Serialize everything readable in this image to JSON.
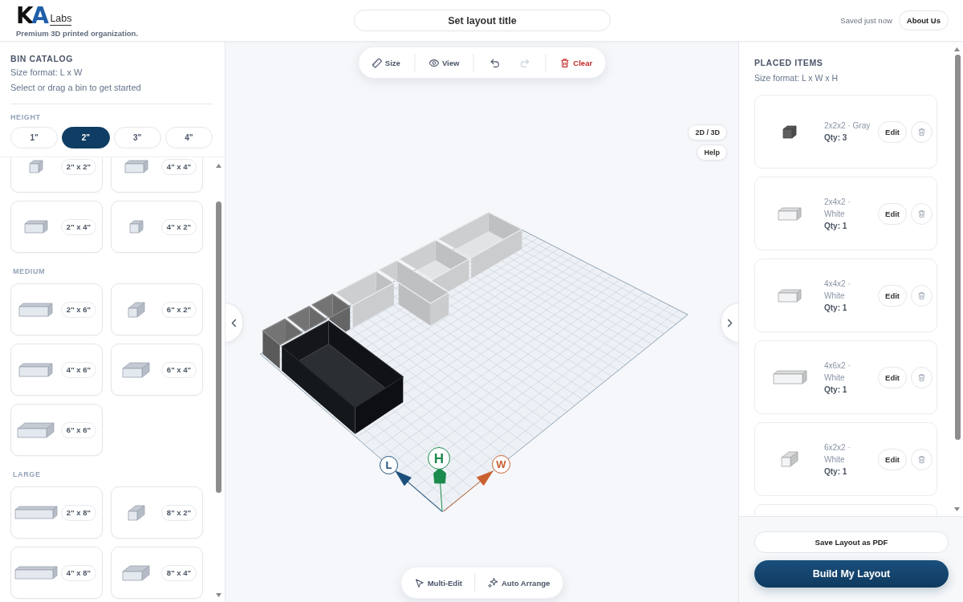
{
  "header": {
    "logo": {
      "mark": "KA",
      "suffix": "Labs"
    },
    "tagline": "Premium 3D printed organization.",
    "title_button": "Set layout title",
    "save_status": "Saved just now",
    "about_button": "About Us"
  },
  "catalog": {
    "title": "BIN CATALOG",
    "size_format": "Size format: L x W",
    "hint": "Select or drag a bin to get started",
    "height_label": "HEIGHT",
    "heights": [
      {
        "label": "1\"",
        "selected": false
      },
      {
        "label": "2\"",
        "selected": true
      },
      {
        "label": "3\"",
        "selected": false
      },
      {
        "label": "4\"",
        "selected": false
      }
    ],
    "sections": [
      {
        "bins": [
          {
            "label": "2\" x 2\"",
            "kind": "cube"
          },
          {
            "label": "4\" x 4\"",
            "kind": "wide"
          },
          {
            "label": "2\" x 4\"",
            "kind": "wide"
          },
          {
            "label": "4\" x 2\"",
            "kind": "cube"
          }
        ]
      },
      {
        "title": "MEDIUM",
        "bins": [
          {
            "label": "2\" x 6\"",
            "kind": "long"
          },
          {
            "label": "6\" x 2\"",
            "kind": "deep"
          },
          {
            "label": "4\" x 6\"",
            "kind": "long"
          },
          {
            "label": "6\" x 4\"",
            "kind": "block"
          },
          {
            "label": "6\" x 6\"",
            "kind": "slab"
          }
        ]
      },
      {
        "title": "LARGE",
        "bins": [
          {
            "label": "2\" x 8\"",
            "kind": "strip"
          },
          {
            "label": "8\" x 2\"",
            "kind": "deep"
          },
          {
            "label": "4\" x 8\"",
            "kind": "strip"
          },
          {
            "label": "8\" x 4\"",
            "kind": "block"
          }
        ]
      }
    ]
  },
  "toolbar": {
    "size": {
      "label": "Size"
    },
    "view": {
      "label": "View"
    },
    "undo": {
      "disabled": false
    },
    "redo": {
      "disabled": true
    },
    "clear": {
      "label": "Clear"
    }
  },
  "view_controls": {
    "mode_toggle": "2D / 3D",
    "help": "Help"
  },
  "scene": {
    "axes": [
      {
        "label": "L",
        "color": "#1d4f7c"
      },
      {
        "label": "H",
        "color": "#1b8a4c"
      },
      {
        "label": "W",
        "color": "#c9602f"
      }
    ]
  },
  "actions": {
    "multi_edit": "Multi-Edit",
    "auto_arrange": "Auto Arrange"
  },
  "placed_items": {
    "title": "PLACED ITEMS",
    "size_format": "Size format: L x W x H",
    "items": [
      {
        "spec": "2x2x2 · Gray",
        "qty": "Qty: 3",
        "edit": "Edit",
        "kind": "cube",
        "color": "#5f5f5f"
      },
      {
        "spec": "2x4x2 · White",
        "qty": "Qty: 1",
        "edit": "Edit",
        "kind": "wide",
        "color": "#f3f4f5"
      },
      {
        "spec": "4x4x2 · White",
        "qty": "Qty: 1",
        "edit": "Edit",
        "kind": "wide",
        "color": "#f3f4f5"
      },
      {
        "spec": "4x6x2 · White",
        "qty": "Qty: 1",
        "edit": "Edit",
        "kind": "long",
        "color": "#f3f4f5"
      },
      {
        "spec": "6x2x2 · White",
        "qty": "Qty: 1",
        "edit": "Edit",
        "kind": "deep",
        "color": "#f3f4f5"
      }
    ]
  },
  "footer": {
    "pdf_button": "Save Layout as PDF",
    "build_button": "Build My Layout"
  }
}
